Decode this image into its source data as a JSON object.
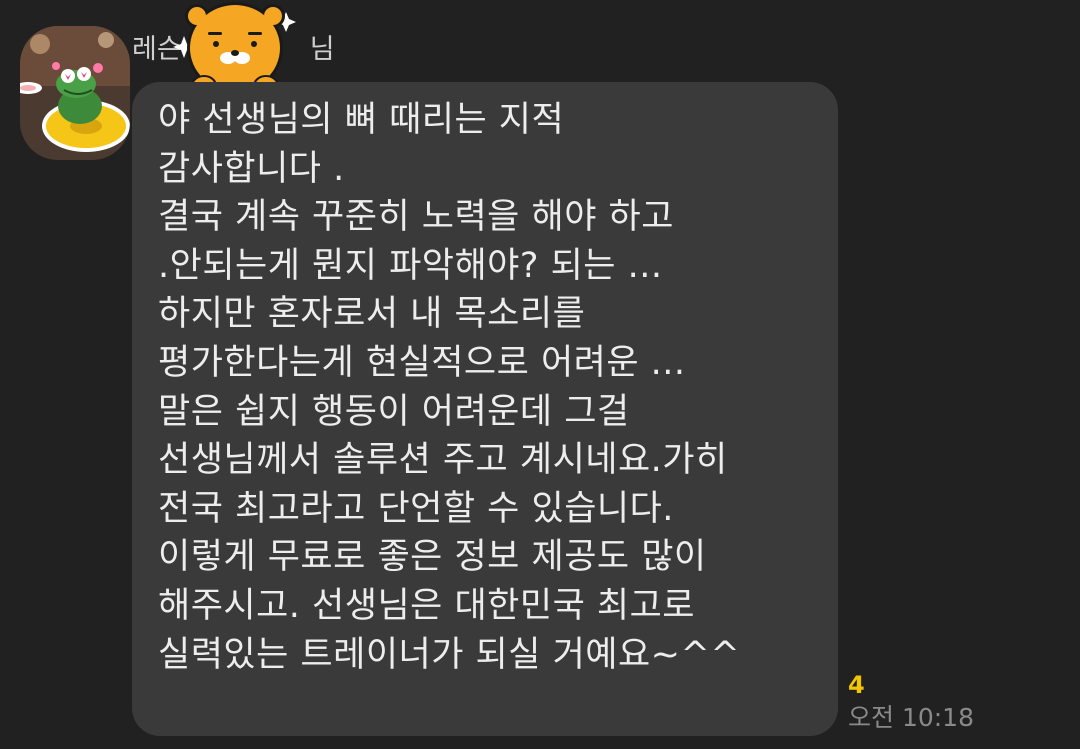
{
  "message": {
    "sender_name": "레슨",
    "sender_suffix": "님",
    "lines": [
      "야 선생님의 뼈 때리는 지적",
      "감사합니다 .",
      "결국 계속 꾸준히 노력을 해야 하고",
      ".안되는게 뭔지 파악해야? 되는 ...",
      "하지만 혼자로서 내 목소리를",
      "평가한다는게 현실적으로 어려운 ...",
      "말은 쉽지 행동이 어려운데 그걸",
      "선생님께서 솔루션 주고 계시네요.가히",
      "전국 최고라고 단언할 수 있습니다.",
      "이렇게 무료로 좋은 정보 제공도 많이",
      "해주시고. 선생님은 대한민국 최고로",
      "실력있는  트레이너가 되실 거예요~^^"
    ],
    "unread_count": "4",
    "time": "오전 10:18"
  },
  "colors": {
    "background": "#212121",
    "bubble": "#3a3a3a",
    "message_text": "#ededed",
    "unread": "#f2c700",
    "time": "#8a8a8a"
  },
  "icons": {
    "avatar": "profile-photo-with-crocodile-sticker",
    "name_sticker": "ryan-bear-sticker"
  }
}
